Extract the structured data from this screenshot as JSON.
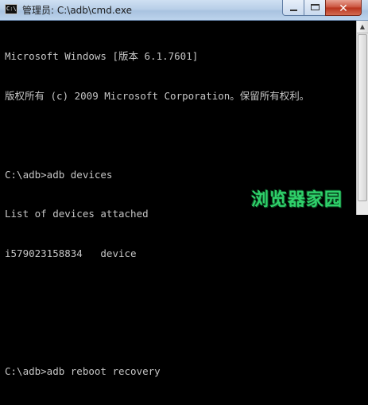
{
  "window": {
    "title": "管理员: C:\\adb\\cmd.exe",
    "app_icon_text": "C:\\",
    "buttons": {
      "minimize_icon": "minimize-icon",
      "maximize_icon": "maximize-icon",
      "close_icon": "close-icon",
      "close_glyph": "✕"
    }
  },
  "console": {
    "lines": [
      "Microsoft Windows [版本 6.1.7601]",
      "版权所有 (c) 2009 Microsoft Corporation。保留所有权利。",
      "",
      "C:\\adb>adb devices",
      "List of devices attached",
      "i579023158834   device",
      "",
      "",
      "C:\\adb>adb reboot recovery"
    ]
  },
  "scrollbar": {
    "up_arrow": "▲"
  },
  "watermark": {
    "text": "浏览器家园"
  },
  "colors": {
    "console_background": "#000000",
    "console_text": "#c6c6c6",
    "titlebar": "#b9cfe8",
    "close_button": "#c9503a",
    "watermark": "#2fd06a"
  }
}
